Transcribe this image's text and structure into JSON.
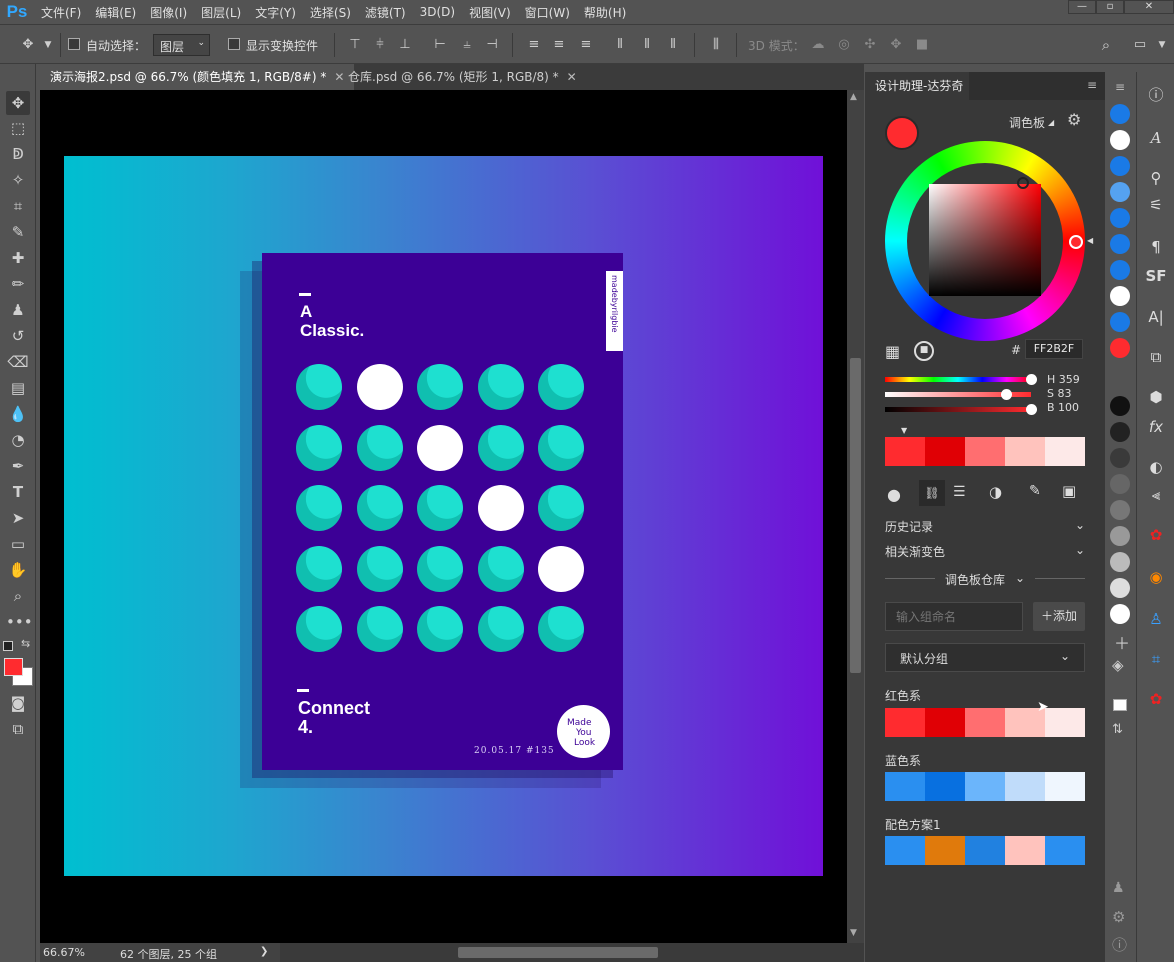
{
  "app": {
    "logo": "Ps"
  },
  "menu": [
    "文件(F)",
    "编辑(E)",
    "图像(I)",
    "图层(L)",
    "文字(Y)",
    "选择(S)",
    "滤镜(T)",
    "3D(D)",
    "视图(V)",
    "窗口(W)",
    "帮助(H)"
  ],
  "window_controls": {
    "minimize": "—",
    "restore": "▫",
    "close": "✕"
  },
  "options": {
    "auto_select_label": "自动选择：",
    "auto_select_value": "图层",
    "show_transform_label": "显示变换控件",
    "mode_3d_label": "3D 模式："
  },
  "tabs": [
    {
      "label": "演示海报2.psd @ 66.7% (颜色填充 1, RGB/8#) *",
      "close": "✕"
    },
    {
      "label": "仓库.psd @ 66.7% (矩形 1, RGB/8) *",
      "close": "✕"
    }
  ],
  "poster": {
    "title_line1": "A",
    "title_line2": "Classic.",
    "side_tag": "madebyrilgbie",
    "bottom_line1": "Connect",
    "bottom_line2": "4.",
    "date": "20.05.17  #135",
    "badge_line1": "Made",
    "badge_line2": "You",
    "badge_line3": "Look",
    "grid": [
      [
        "teal",
        "white",
        "teal",
        "teal",
        "teal"
      ],
      [
        "teal",
        "teal",
        "white",
        "teal",
        "teal"
      ],
      [
        "teal",
        "teal",
        "teal",
        "white",
        "teal"
      ],
      [
        "teal",
        "teal",
        "teal",
        "teal",
        "white"
      ],
      [
        "teal",
        "teal",
        "teal",
        "teal",
        "teal"
      ]
    ]
  },
  "status": {
    "zoom": "66.67%",
    "info": "62 个图层, 25 个组",
    "arrow": "❯"
  },
  "panel": {
    "title": "设计助理-达芬奇",
    "palette_label": "调色板",
    "current_color": "#FF2B2F",
    "hex_prefix": "#",
    "hex_value": "FF2B2F",
    "h_label": "H",
    "h_value": "359",
    "s_label": "S",
    "s_value": "83",
    "b_label": "B",
    "b_value": "100",
    "hue_fraction": 0.997,
    "sat_fraction": 0.83,
    "bright_fraction": 1.0,
    "shades": [
      "#ff2b2f",
      "#e00005",
      "#ff6e70",
      "#ffc3bd",
      "#fde9e8"
    ],
    "history_label": "历史记录",
    "gradient_label": "相关渐变色",
    "library_label": "调色板仓库",
    "group_placeholder": "输入组命名",
    "add_label": "添加",
    "group_select": "默认分组",
    "groups": [
      {
        "name": "红色系",
        "colors": [
          "#ff2b2f",
          "#e00005",
          "#ff6e70",
          "#ffc3bd",
          "#fde9e8"
        ]
      },
      {
        "name": "蓝色系",
        "colors": [
          "#2a8ff0",
          "#0870e0",
          "#6bb5fb",
          "#c0dcfa",
          "#eff6fe"
        ]
      },
      {
        "name": "配色方案1",
        "colors": [
          "#2a8ff0",
          "#e07a0c",
          "#2181e0",
          "#ffc3bd",
          "#2a8ff0"
        ]
      }
    ]
  },
  "strip_swatches": [
    "#1a7ae6",
    "#ffffff",
    "#1a7ae6",
    "#55a2f0",
    "#1a7ae6",
    "#1a7ae6",
    "#1a7ae6",
    "#ffffff",
    "#1a7ae6",
    "#ff2b2f",
    "#111111",
    "#222222",
    "#3a3a3a",
    "#666666",
    "#777777",
    "#999999",
    "#bbbbbb",
    "#dddddd",
    "#ffffff"
  ],
  "colors": {
    "fg": "#ff2b2f",
    "bg": "#ffffff",
    "teal": "#16cfc0",
    "poster_bg": "#3c0096"
  }
}
